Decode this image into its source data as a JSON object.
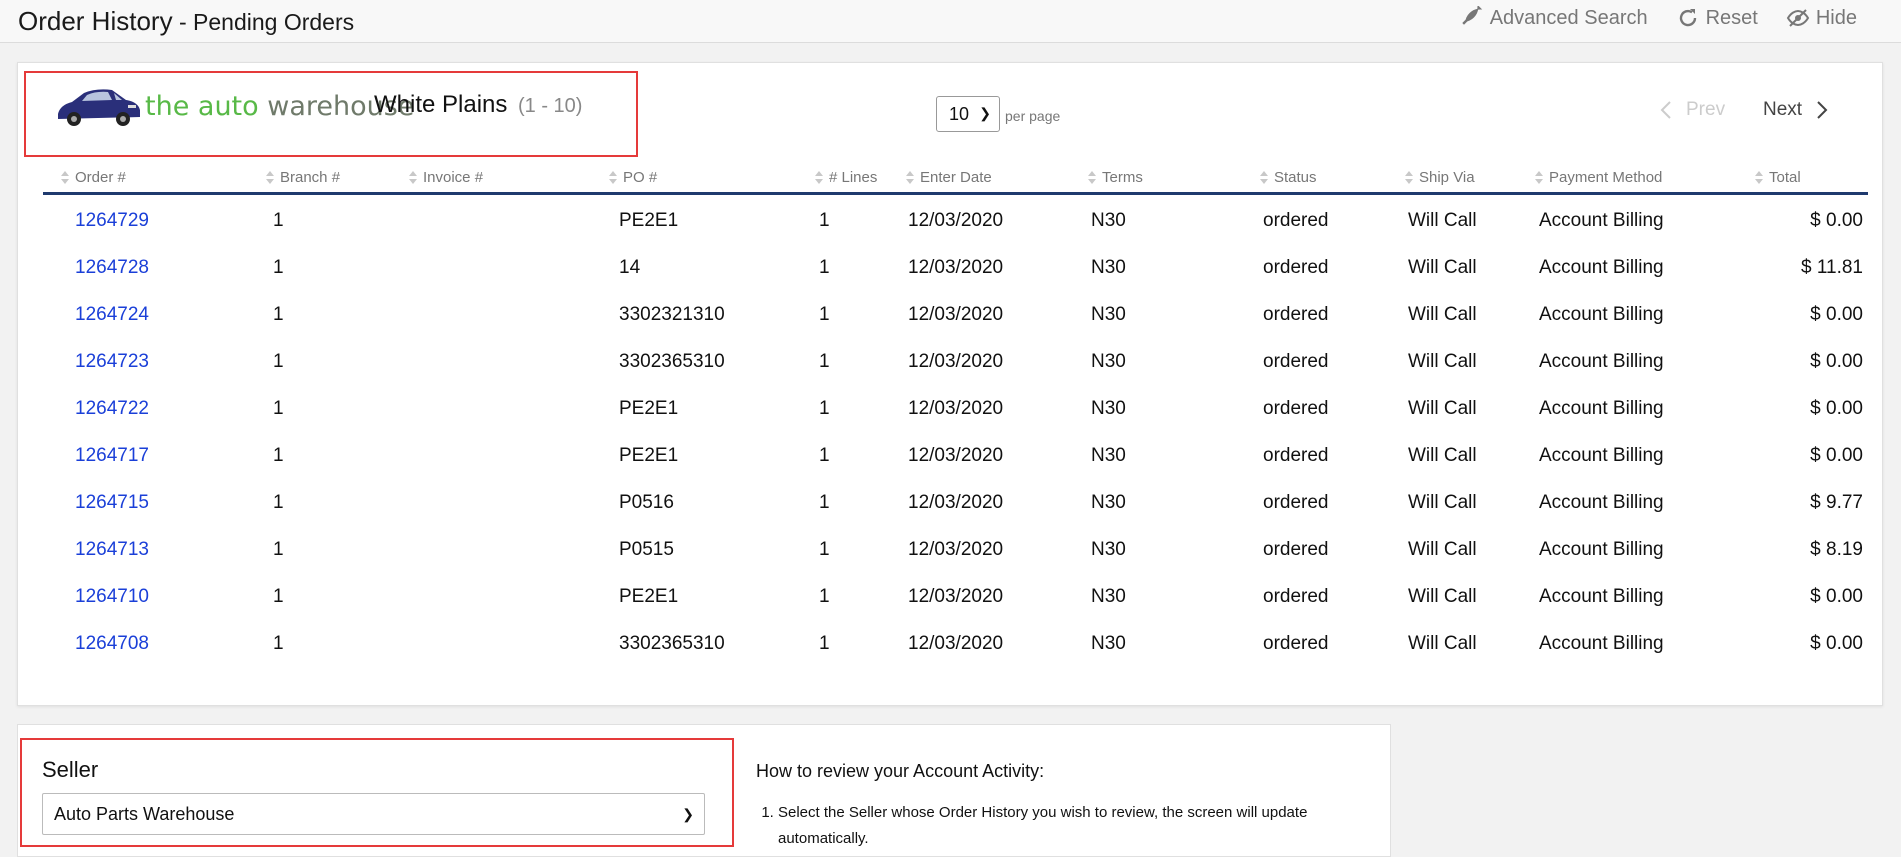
{
  "header": {
    "title": "Order History",
    "separator": " - ",
    "subtitle": "Pending Orders",
    "actions": [
      {
        "label": "Advanced Search",
        "icon": "feather-icon"
      },
      {
        "label": "Reset",
        "icon": "refresh-icon"
      },
      {
        "label": "Hide",
        "icon": "eye-slash-icon"
      }
    ]
  },
  "seller_header": {
    "logo_text_green": "the auto",
    "logo_text_dark": "warehouse",
    "branch": "White Plains",
    "range": "(1 - 10)"
  },
  "pagination": {
    "per_page_value": "10",
    "per_page_label": "per page",
    "prev_label": "Prev",
    "next_label": "Next"
  },
  "table": {
    "columns": [
      "Order #",
      "Branch #",
      "Invoice #",
      "PO #",
      "# Lines",
      "Enter Date",
      "Terms",
      "Status",
      "Ship Via",
      "Payment Method",
      "Total"
    ],
    "rows": [
      {
        "order": "1264729",
        "branch": "1",
        "invoice": "",
        "po": "PE2E1",
        "lines": "1",
        "date": "12/03/2020",
        "terms": "N30",
        "status": "ordered",
        "ship": "Will Call",
        "payment": "Account Billing",
        "total": "$ 0.00"
      },
      {
        "order": "1264728",
        "branch": "1",
        "invoice": "",
        "po": "14",
        "lines": "1",
        "date": "12/03/2020",
        "terms": "N30",
        "status": "ordered",
        "ship": "Will Call",
        "payment": "Account Billing",
        "total": "$ 11.81"
      },
      {
        "order": "1264724",
        "branch": "1",
        "invoice": "",
        "po": "3302321310",
        "lines": "1",
        "date": "12/03/2020",
        "terms": "N30",
        "status": "ordered",
        "ship": "Will Call",
        "payment": "Account Billing",
        "total": "$ 0.00"
      },
      {
        "order": "1264723",
        "branch": "1",
        "invoice": "",
        "po": "3302365310",
        "lines": "1",
        "date": "12/03/2020",
        "terms": "N30",
        "status": "ordered",
        "ship": "Will Call",
        "payment": "Account Billing",
        "total": "$ 0.00"
      },
      {
        "order": "1264722",
        "branch": "1",
        "invoice": "",
        "po": "PE2E1",
        "lines": "1",
        "date": "12/03/2020",
        "terms": "N30",
        "status": "ordered",
        "ship": "Will Call",
        "payment": "Account Billing",
        "total": "$ 0.00"
      },
      {
        "order": "1264717",
        "branch": "1",
        "invoice": "",
        "po": "PE2E1",
        "lines": "1",
        "date": "12/03/2020",
        "terms": "N30",
        "status": "ordered",
        "ship": "Will Call",
        "payment": "Account Billing",
        "total": "$ 0.00"
      },
      {
        "order": "1264715",
        "branch": "1",
        "invoice": "",
        "po": "P0516",
        "lines": "1",
        "date": "12/03/2020",
        "terms": "N30",
        "status": "ordered",
        "ship": "Will Call",
        "payment": "Account Billing",
        "total": "$ 9.77"
      },
      {
        "order": "1264713",
        "branch": "1",
        "invoice": "",
        "po": "P0515",
        "lines": "1",
        "date": "12/03/2020",
        "terms": "N30",
        "status": "ordered",
        "ship": "Will Call",
        "payment": "Account Billing",
        "total": "$ 8.19"
      },
      {
        "order": "1264710",
        "branch": "1",
        "invoice": "",
        "po": "PE2E1",
        "lines": "1",
        "date": "12/03/2020",
        "terms": "N30",
        "status": "ordered",
        "ship": "Will Call",
        "payment": "Account Billing",
        "total": "$ 0.00"
      },
      {
        "order": "1264708",
        "branch": "1",
        "invoice": "",
        "po": "3302365310",
        "lines": "1",
        "date": "12/03/2020",
        "terms": "N30",
        "status": "ordered",
        "ship": "Will Call",
        "payment": "Account Billing",
        "total": "$ 0.00"
      }
    ]
  },
  "seller_filter": {
    "label": "Seller",
    "selected": "Auto Parts Warehouse"
  },
  "help": {
    "title": "How to review your Account Activity:",
    "steps": [
      "Select the Seller whose Order History you wish to review, the screen will update automatically."
    ]
  },
  "colors": {
    "link": "#1a3fd8",
    "highlight_border": "#e53a3a",
    "table_rule": "#1f3a6e",
    "logo_green": "#58b947"
  }
}
